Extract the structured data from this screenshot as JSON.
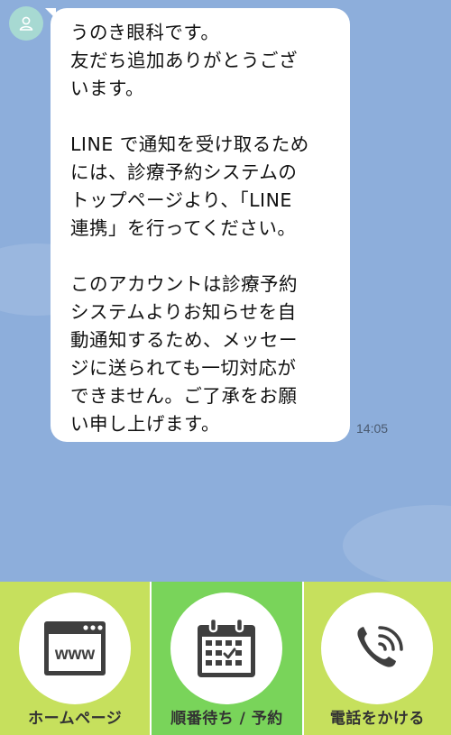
{
  "chat": {
    "message": "うのき眼科です。\n友だち追加ありがとうござ\nいます。\n\nLINE で通知を受け取るため\nには、診療予約システムの\nトップページより、「LINE\n連携」を行ってください。\n\nこのアカウントは診療予約\nシステムよりお知らせを自\n動通知するため、メッセー\nジに送られても一切対応が\nできません。ご了承をお願\nい申し上げます。",
    "time": "14:05"
  },
  "menu": {
    "items": [
      {
        "label": "ホームページ",
        "icon": "browser-www-icon",
        "icon_text": "www"
      },
      {
        "label": "順番待ち / 予約",
        "icon": "calendar-icon"
      },
      {
        "label": "電話をかける",
        "icon": "phone-icon"
      }
    ]
  },
  "colors": {
    "chat_background": "#8daedb",
    "menu_side": "#c6e05d",
    "menu_center": "#79d45a",
    "avatar": "#a7d9d2"
  }
}
